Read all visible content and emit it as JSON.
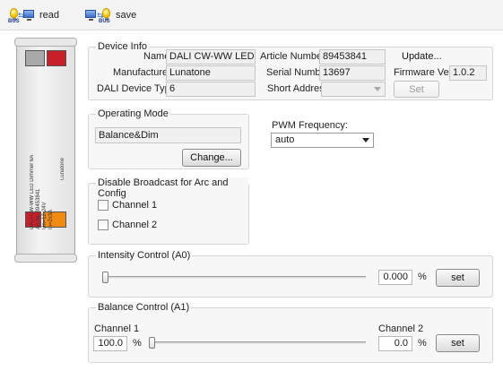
{
  "toolbar": {
    "read_label": "read",
    "save_label": "save"
  },
  "device_info": {
    "legend": "Device Info",
    "name_label": "Name",
    "name_value": "DALI CW-WW LED D...",
    "manufacturer_label": "Manufacturer",
    "manufacturer_value": "Lunatone",
    "device_type_label": "DALI Device Type",
    "device_type_value": "6",
    "article_label": "Article Number",
    "article_value": "89453841",
    "serial_label": "Serial Number",
    "serial_value": "13697",
    "short_address_label": "Short Address",
    "short_address_value": "",
    "update_label": "Update...",
    "firmware_label": "Firmware Ver",
    "firmware_value": "1.0.2",
    "set_label": "Set"
  },
  "device_image": {
    "text_lines": [
      "DALI CW-WW LED Dimmer 6A",
      "Art.Nr. 89453841",
      "Un=12-24V",
      "In=2x3A"
    ],
    "brand": "Lunatone"
  },
  "operating_mode": {
    "legend": "Operating Mode",
    "value": "Balance&Dim",
    "change_label": "Change..."
  },
  "pwm": {
    "label": "PWM Frequency:",
    "selected": "auto"
  },
  "broadcast": {
    "legend": "Disable Broadcast for Arc and Config",
    "channels": [
      {
        "label": "Channel 1"
      },
      {
        "label": "Channel 2"
      }
    ]
  },
  "intensity": {
    "legend": "Intensity Control (A0)",
    "value": "0.000",
    "unit": "%",
    "set_label": "set",
    "level": 0.0
  },
  "balance": {
    "legend": "Balance Control (A1)",
    "channel1_label": "Channel 1",
    "channel1_value": "100.0",
    "channel2_label": "Channel 2",
    "channel2_value": "0.0",
    "unit": "%",
    "set_label": "set",
    "level": 0.0
  }
}
